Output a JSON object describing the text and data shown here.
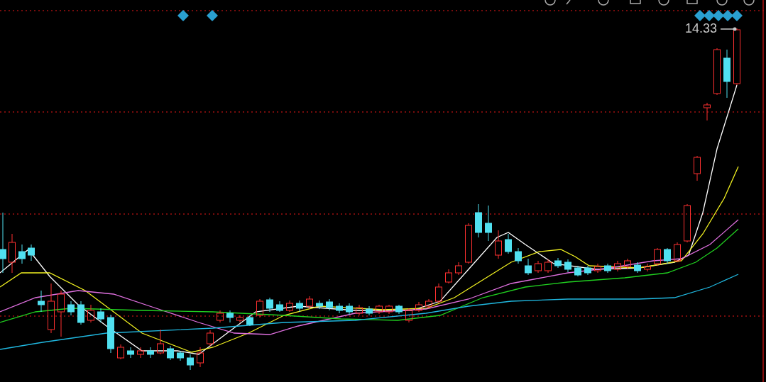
{
  "chart": {
    "price_label": "14.33"
  }
}
